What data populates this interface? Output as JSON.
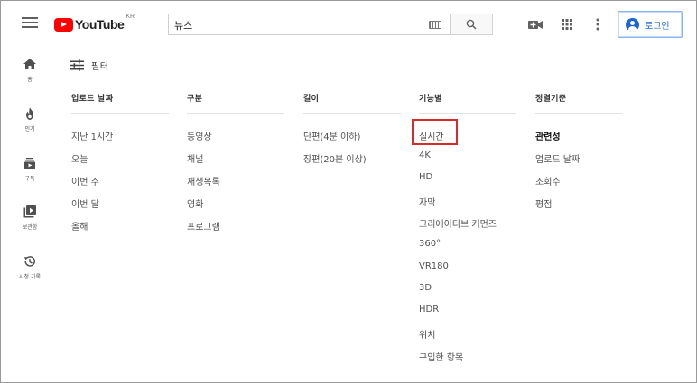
{
  "header": {
    "logo_text": "YouTube",
    "region": "KR",
    "search_value": "뉴스",
    "signin_label": "로그인"
  },
  "icons": [
    "menu-icon",
    "youtube-logo-icon",
    "keyboard-icon",
    "search-icon",
    "create-video-icon",
    "apps-grid-icon",
    "more-vert-icon",
    "account-icon",
    "home-icon",
    "trending-icon",
    "subscriptions-icon",
    "library-icon",
    "history-icon",
    "filter-icon"
  ],
  "guide": [
    {
      "label": "홈"
    },
    {
      "label": "인기"
    },
    {
      "label": "구독"
    },
    {
      "label": "보관함"
    },
    {
      "label": "시청 기록"
    }
  ],
  "filter": {
    "title": "필터",
    "columns": [
      {
        "header": "업로드 날짜",
        "options": [
          "지난 1시간",
          "오늘",
          "이번 주",
          "이번 달",
          "올해"
        ]
      },
      {
        "header": "구분",
        "options": [
          "동영상",
          "채널",
          "재생목록",
          "영화",
          "프로그램"
        ]
      },
      {
        "header": "길이",
        "options": [
          "단편(4분 이하)",
          "장편(20분 이상)"
        ]
      },
      {
        "header": "기능별",
        "options": [
          "실시간",
          "4K",
          "HD",
          "자막",
          "크리에이티브 커먼즈",
          "360°",
          "VR180",
          "3D",
          "HDR",
          "위치",
          "구입한 항목"
        ]
      },
      {
        "header": "정렬기준",
        "options": [
          "관련성",
          "업로드 날짜",
          "조회수",
          "평점"
        ],
        "selected": "관련성"
      }
    ],
    "highlighted_option": "실시간"
  },
  "colors": {
    "youtube_red": "#ff0000",
    "highlight_red": "#d42b2b",
    "signin_blue": "#1a66d8"
  }
}
